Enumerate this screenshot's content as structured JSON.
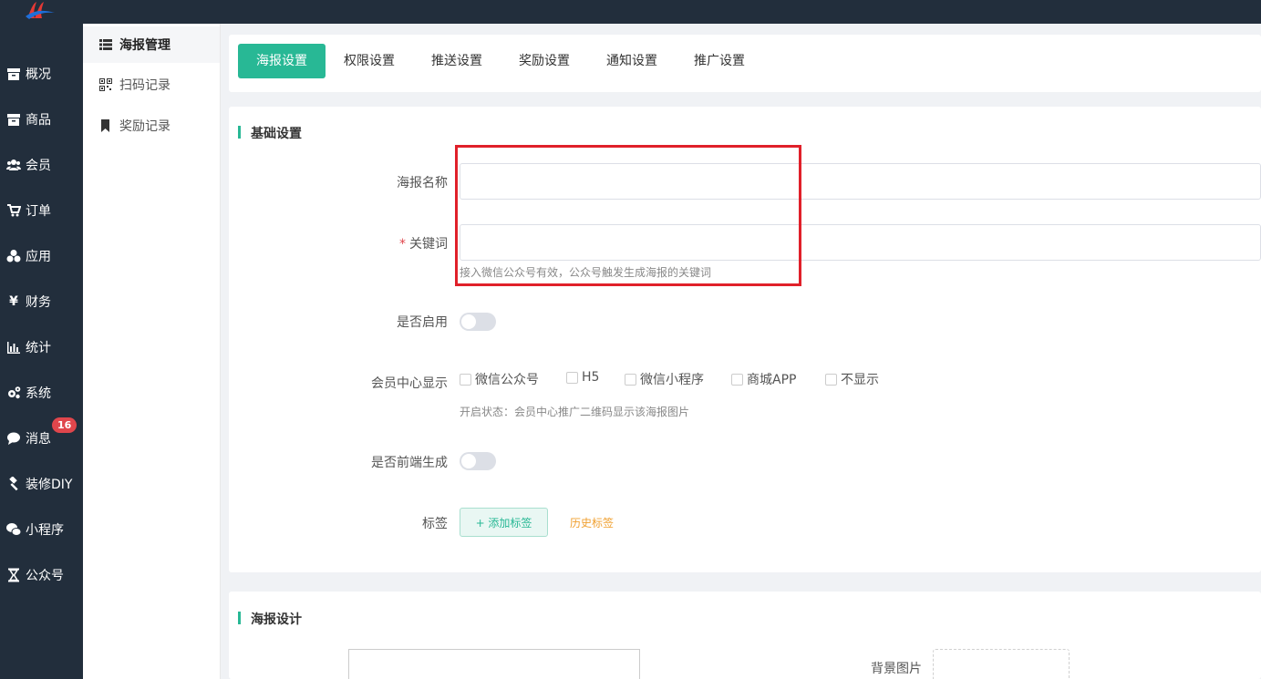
{
  "nav": {
    "items": [
      {
        "label": "概况",
        "icon": "archive-icon"
      },
      {
        "label": "商品",
        "icon": "archive-icon"
      },
      {
        "label": "会员",
        "icon": "users-icon"
      },
      {
        "label": "订单",
        "icon": "cart-icon"
      },
      {
        "label": "应用",
        "icon": "cubes-icon"
      },
      {
        "label": "财务",
        "icon": "yen-icon"
      },
      {
        "label": "统计",
        "icon": "bar-chart-icon"
      },
      {
        "label": "系统",
        "icon": "gears-icon"
      },
      {
        "label": "消息",
        "icon": "chat-bubble-icon",
        "badge": "16"
      },
      {
        "label": "装修DIY",
        "icon": "gavel-icon"
      },
      {
        "label": "小程序",
        "icon": "wechat-icon"
      },
      {
        "label": "公众号",
        "icon": "hourglass-icon"
      }
    ]
  },
  "subnav": {
    "items": [
      {
        "label": "海报管理",
        "icon": "list-icon",
        "active": true
      },
      {
        "label": "扫码记录",
        "icon": "qrcode-icon"
      },
      {
        "label": "奖励记录",
        "icon": "bookmark-icon"
      }
    ]
  },
  "tabs": [
    {
      "label": "海报设置",
      "active": true
    },
    {
      "label": "权限设置"
    },
    {
      "label": "推送设置"
    },
    {
      "label": "奖励设置"
    },
    {
      "label": "通知设置"
    },
    {
      "label": "推广设置"
    }
  ],
  "basic": {
    "title": "基础设置",
    "poster_name_label": "海报名称",
    "poster_name_value": "",
    "keyword_required": "*",
    "keyword_label": "关键词",
    "keyword_value": "",
    "keyword_hint": "接入微信公众号有效，公众号触发生成海报的关键词",
    "enable_label": "是否启用",
    "enable_on": false,
    "member_center_label": "会员中心显示",
    "member_center_options": [
      {
        "label": "微信公众号",
        "checked": false
      },
      {
        "label": "H5",
        "checked": false
      },
      {
        "label": "微信小程序",
        "checked": false
      },
      {
        "label": "商城APP",
        "checked": false
      },
      {
        "label": "不显示",
        "checked": false
      }
    ],
    "member_center_hint": "开启状态：会员中心推广二维码显示该海报图片",
    "frontend_label": "是否前端生成",
    "frontend_on": false,
    "tag_label": "标签",
    "add_tag_label": "+ 添加标签",
    "history_tag_label": "历史标签"
  },
  "design": {
    "title": "海报设计",
    "bg_image_label": "背景图片"
  },
  "colors": {
    "accent": "#28b895",
    "sidebar": "#222e3c",
    "highlight": "#e0202a",
    "badge": "#e0464c"
  }
}
